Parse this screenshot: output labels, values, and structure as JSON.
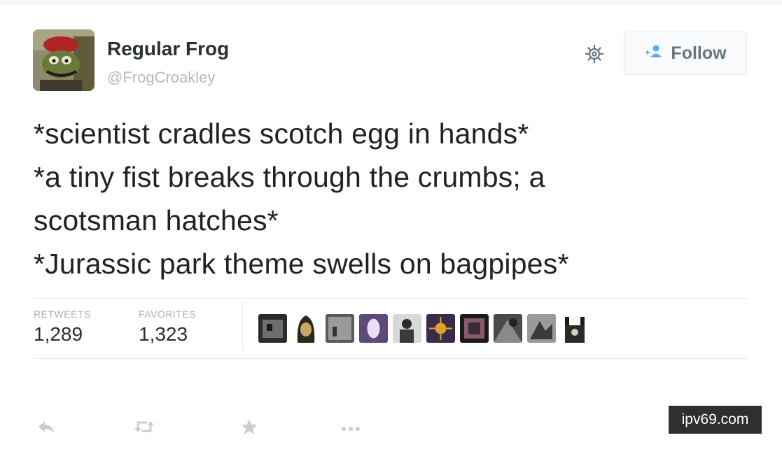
{
  "tweet": {
    "display_name": "Regular Frog",
    "handle": "@FrogCroakley",
    "follow_label": "Follow",
    "lines": [
      "*scientist cradles scotch egg in hands*",
      "*a tiny fist breaks through the crumbs; a",
      "scotsman hatches*",
      "*Jurassic park theme swells on bagpipes*"
    ],
    "stats": {
      "retweets_label": "RETWEETS",
      "retweets_value": "1,289",
      "favorites_label": "FAVORITES",
      "favorites_value": "1,323"
    }
  },
  "watermark": "ipv69.com",
  "icons": [
    "gear-icon",
    "add-user-icon",
    "reply-icon",
    "retweet-icon",
    "favorite-star-icon",
    "more-icon"
  ]
}
